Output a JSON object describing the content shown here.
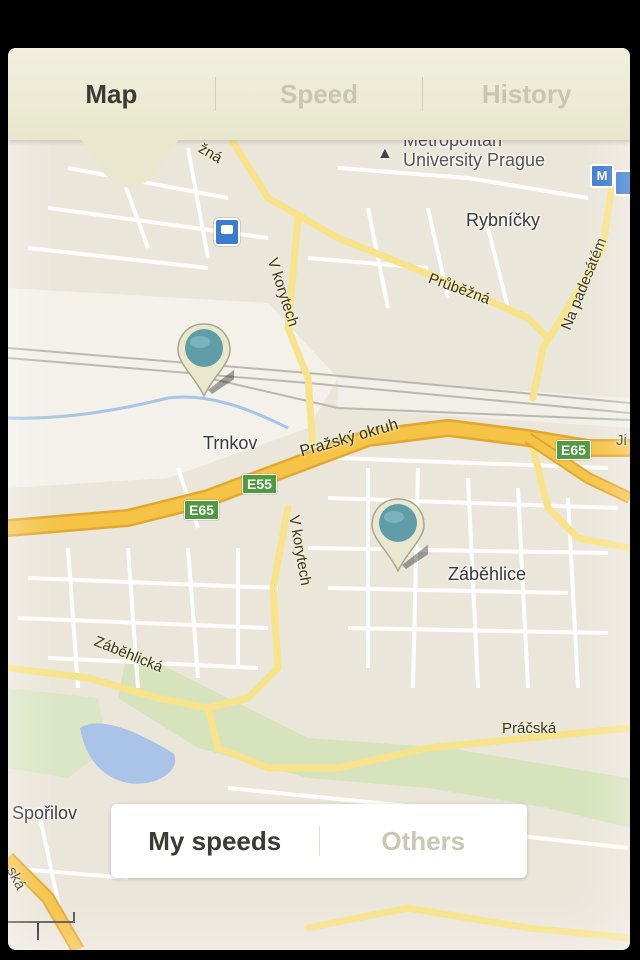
{
  "tabs": [
    {
      "label": "Map",
      "active": true
    },
    {
      "label": "Speed",
      "active": false
    },
    {
      "label": "History",
      "active": false
    }
  ],
  "map": {
    "places": {
      "university": "Metropolitan\nUniversity Prague",
      "university_line1": "Metropolitan",
      "university_line2": "University Prague",
      "rybnicky": "Rybníčky",
      "trnkov": "Trnkov",
      "zabehlice": "Záběhlice",
      "sporilov": "Spořilov"
    },
    "roads": {
      "prubezna": "Průběžná",
      "na_padesatem": "Na padesátém",
      "v_korytech_1": "V korytech",
      "v_korytech_2": "V korytech",
      "prazsky_okruh": "Pražský okruh",
      "zabehlicka": "Záběhlická",
      "pracska": "Práčská",
      "zna_top": "žná",
      "ska_left": "ská",
      "ji_right": "Ji"
    },
    "shields": {
      "e65_left": "E65",
      "e55": "E55",
      "e65_right": "E65"
    },
    "icons": {
      "metro": "M",
      "tram": "tram-icon"
    },
    "colors": {
      "land": "#ebe6da",
      "road_major": "#f5c346",
      "road_major_edge": "#e0a830",
      "road_minor": "#ffffff",
      "road_mid": "#f9e98a",
      "water": "#a9c4e6",
      "green": "#cfe0b0",
      "pin_body": "#e9e8cf",
      "pin_dot": "#5f9ea8"
    }
  },
  "speed_toggle": {
    "my_speeds": "My speeds",
    "others": "Others"
  }
}
